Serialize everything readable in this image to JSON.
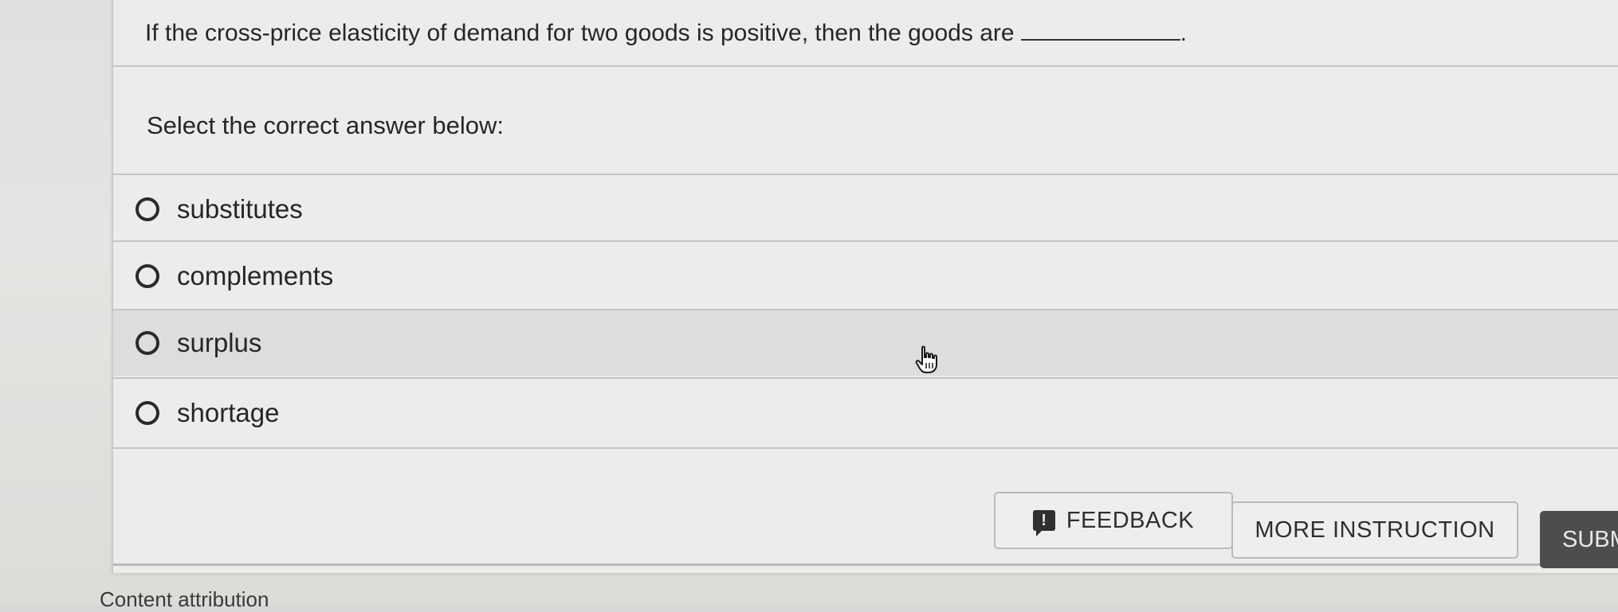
{
  "question": {
    "text": "If the cross-price elasticity of demand for two goods  is positive, then the goods are",
    "after_blank": "."
  },
  "prompt": "Select the correct answer below:",
  "options": [
    {
      "label": "substitutes"
    },
    {
      "label": "complements"
    },
    {
      "label": "surplus"
    },
    {
      "label": "shortage"
    }
  ],
  "buttons": {
    "feedback": "FEEDBACK",
    "more_instruction": "MORE INSTRUCTION",
    "submit": "SUBM"
  },
  "footer": {
    "attribution": "Content attribution"
  },
  "icons": {
    "feedback": "feedback-icon",
    "cursor": "hand-pointer-icon"
  }
}
